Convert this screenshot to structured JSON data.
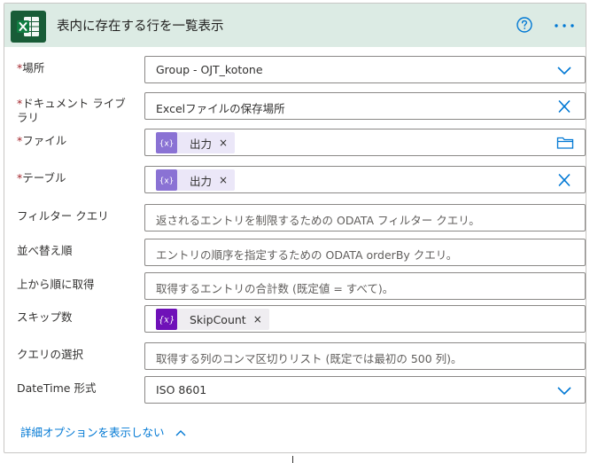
{
  "header": {
    "title": "表内に存在する行を一覧表示",
    "app_icon": "excel-icon",
    "help_icon": "question-circle-icon",
    "more_icon": "more-horizontal-icon",
    "background": "#dcebe4",
    "brand_color": "#185c37"
  },
  "fields": {
    "location": {
      "required_mark": "*",
      "label": "場所",
      "value": "Group - OJT_kotone",
      "icon": "chevron-down-icon"
    },
    "library": {
      "required_mark": "*",
      "label_line1": "ドキュメント ライブ",
      "label_line2": "ラリ",
      "value": "Excelファイルの保存場所",
      "icon": "clear-icon"
    },
    "file": {
      "required_mark": "*",
      "label": "ファイル",
      "token_label": "出力",
      "token_remove": "×",
      "token_icon": "expression-icon",
      "icon": "folder-icon"
    },
    "table": {
      "required_mark": "*",
      "label": "テーブル",
      "token_label": "出力",
      "token_remove": "×",
      "token_icon": "expression-icon",
      "icon": "clear-icon"
    },
    "filter_query": {
      "label": "フィルター クエリ",
      "placeholder": "返されるエントリを制限するための ODATA フィルター クエリ。"
    },
    "order_by": {
      "label": "並べ替え順",
      "placeholder": "エントリの順序を指定するための ODATA orderBy クエリ。"
    },
    "top_count": {
      "label": "上から順に取得",
      "placeholder": "取得するエントリの合計数 (既定値 = すべて)。"
    },
    "skip_count": {
      "label": "スキップ数",
      "token_label": "SkipCount",
      "token_remove": "×",
      "token_icon": "variable-icon"
    },
    "select_query": {
      "label": "クエリの選択",
      "placeholder": "取得する列のコンマ区切りリスト (既定では最初の 500 列)。"
    },
    "datetime_format": {
      "label": "DateTime 形式",
      "value": "ISO 8601",
      "icon": "chevron-down-icon"
    }
  },
  "advanced_toggle": {
    "label": "詳細オプションを表示しない",
    "icon": "chevron-up-icon"
  },
  "colors": {
    "accent": "#0078d4",
    "required": "#a4262c",
    "token_dynamic": "#8a72d4",
    "token_variable": "#6f11b8"
  }
}
